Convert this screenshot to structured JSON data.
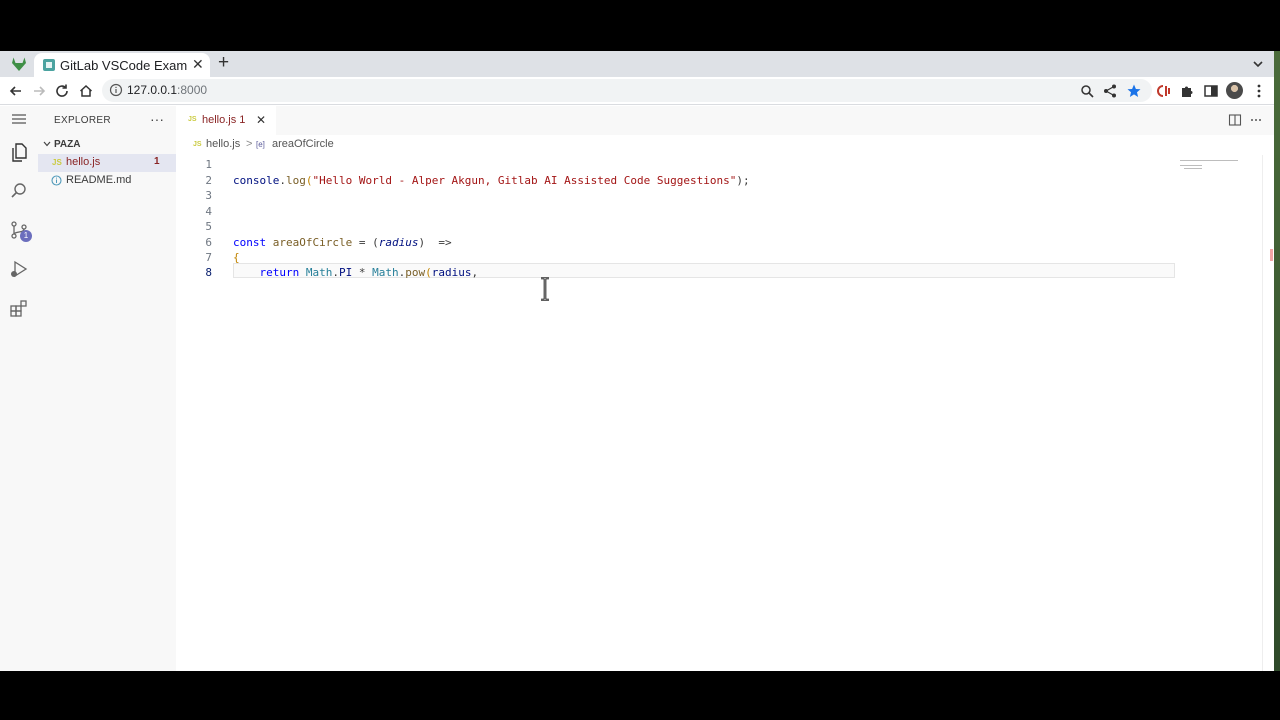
{
  "browser": {
    "tab_title": "GitLab VSCode Example",
    "url_host": "127.0.0.1",
    "url_port": ":8000"
  },
  "explorer": {
    "title": "EXPLORER",
    "more": "···",
    "folder": "PAZA",
    "files": [
      {
        "name": "hello.js",
        "icon": "JS",
        "problems": "1"
      },
      {
        "name": "README.md",
        "icon": "info-icon"
      }
    ]
  },
  "activitybar": {
    "scm_badge": "1"
  },
  "editor": {
    "tab": {
      "icon": "JS",
      "label": "hello.js 1"
    },
    "breadcrumb": {
      "file": "hello.js",
      "separator": ">",
      "symbol_icon": "[e]",
      "symbol": "areaOfCircle"
    },
    "lines": [
      {
        "n": "1",
        "text": ""
      },
      {
        "n": "2",
        "text": "console.log(\"Hello World - Alper Akgun, Gitlab AI Assisted Code Suggestions\");"
      },
      {
        "n": "3",
        "text": ""
      },
      {
        "n": "4",
        "text": ""
      },
      {
        "n": "5",
        "text": ""
      },
      {
        "n": "6",
        "text": "const areaOfCircle = (radius)  =>"
      },
      {
        "n": "7",
        "text": "{"
      },
      {
        "n": "8",
        "text": "    return Math.PI * Math.pow(radius,"
      }
    ],
    "code_parts": {
      "l2_a": "console",
      "l2_b": ".",
      "l2_c": "log",
      "l2_d": "(",
      "l2_e": "\"Hello World - Alper Akgun, Gitlab AI Assisted Code Suggestions\"",
      "l2_f": ");",
      "l6_a": "const ",
      "l6_b": "areaOfCircle",
      "l6_c": " = (",
      "l6_d": "radius",
      "l6_e": ")  =>",
      "l7_a": "{",
      "l8_a": "    return ",
      "l8_b": "Math",
      "l8_c": ".",
      "l8_d": "PI",
      "l8_e": " * ",
      "l8_f": "Math",
      "l8_g": ".",
      "l8_h": "pow",
      "l8_i": "(",
      "l8_j": "radius",
      "l8_k": ","
    }
  },
  "colors": {
    "accent": "#6b6ebd",
    "error": "#8a2525",
    "selection": "#e4e6f1"
  }
}
